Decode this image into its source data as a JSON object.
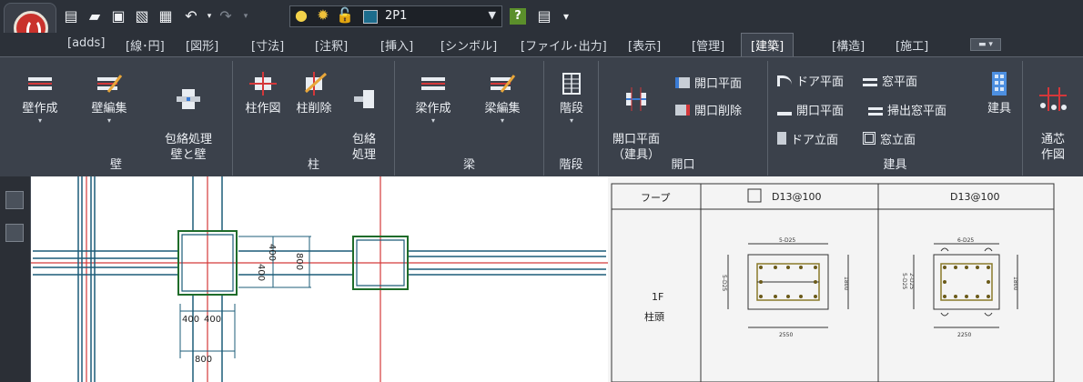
{
  "app": {
    "logo": "app-logo"
  },
  "quick_access": {
    "icons": [
      "new-file-icon",
      "open-folder-icon",
      "save-icon",
      "save-as-icon",
      "print-icon",
      "undo-icon",
      "dropdown-arrow-icon",
      "redo-icon",
      "dropdown-arrow-icon",
      "lightbulb-icon",
      "sun-icon",
      "lock-icon"
    ],
    "layer_name": "2P1",
    "layer_color": "#1d6c8c",
    "after_icons": [
      "help-icon",
      "settings-icon",
      "customize-icon"
    ]
  },
  "tabs": [
    "[adds]",
    "[線･円]",
    "[図形]",
    "[寸法]",
    "[注釈]",
    "[挿入]",
    "[シンボル]",
    "[ファイル･出力]",
    "[表示]",
    "[管理]",
    "[建築]",
    "[構造]",
    "[施工]"
  ],
  "active_tab": "[建築]",
  "ribbon": {
    "groups": [
      {
        "label": "壁",
        "buttons": [
          "壁作成",
          "壁編集",
          "包絡処理\n壁と壁"
        ]
      },
      {
        "label": "柱",
        "buttons": [
          "柱作図",
          "柱削除",
          "包絡\n処理"
        ]
      },
      {
        "label": "梁",
        "buttons": [
          "梁作成",
          "梁編集"
        ]
      },
      {
        "label": "階段",
        "buttons": [
          "階段"
        ]
      },
      {
        "label": "開口",
        "buttons": [
          "開口平面\n（建具）"
        ],
        "small": [
          "開口平面",
          "開口削除"
        ]
      },
      {
        "label": "建具",
        "small": [
          "ドア平面",
          "窓平面",
          "開口平面",
          "掃出窓平面",
          "ドア立面",
          "窓立面"
        ],
        "buttons": [
          "建具"
        ]
      },
      {
        "label": "",
        "buttons": [
          "通芯\n作図"
        ]
      }
    ]
  },
  "drawing": {
    "dimensions": [
      "400",
      "400",
      "400",
      "400",
      "800",
      "800"
    ],
    "table": {
      "header_label": "フープ",
      "col1_value": "D13@100",
      "col2_value": "D13@100",
      "row_label_1": "1F",
      "row_label_2": "柱頭",
      "dim_top_1": "5-D25",
      "dim_top_2": "6-D25",
      "dim_side_1": "5-D25",
      "dim_side_2": "5-D25",
      "dim_side_2b": "2-D25",
      "dim_h_1": "1800",
      "dim_h_2": "1800",
      "dim_bottom_1": "2550",
      "dim_bottom_2": "2250"
    }
  }
}
